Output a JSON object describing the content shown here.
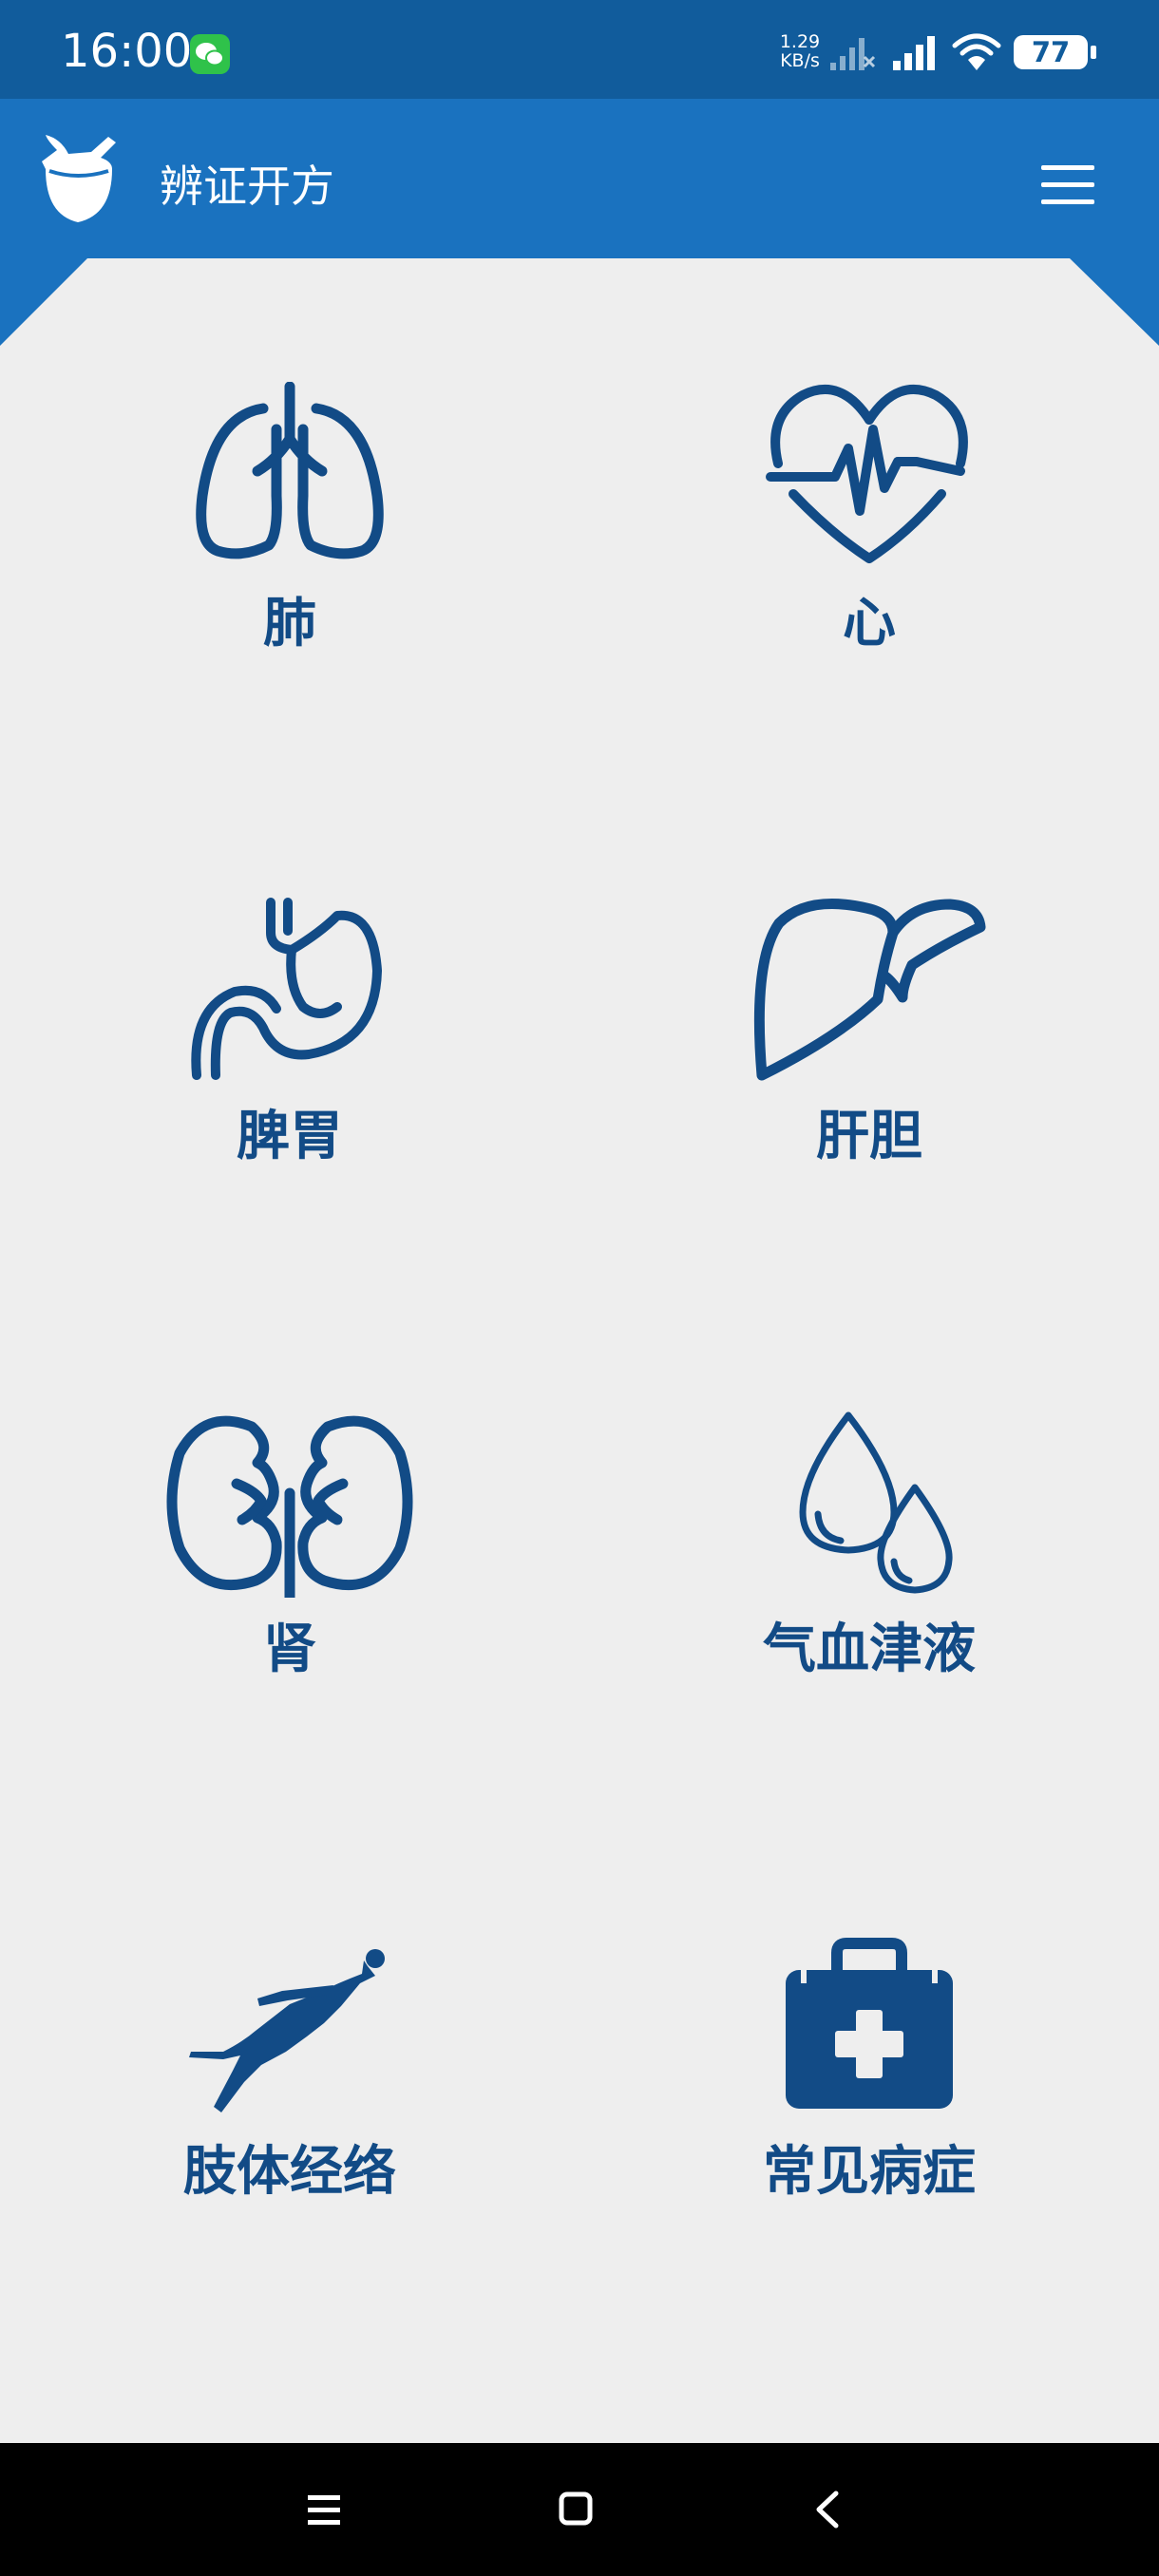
{
  "status_bar": {
    "time": "16:00",
    "net_speed_value": "1.29",
    "net_speed_unit": "KB/s",
    "battery": "77",
    "icons": [
      "wechat-notification-icon",
      "sim-signal-no-service-icon",
      "cellular-signal-icon",
      "wifi-icon",
      "battery-icon"
    ]
  },
  "header": {
    "title": "辨证开方",
    "logo_icon": "mortar-pestle-icon",
    "menu_icon": "hamburger-menu-icon"
  },
  "categories": [
    {
      "label": "肺",
      "icon": "lungs-icon"
    },
    {
      "label": "心",
      "icon": "heart-pulse-icon"
    },
    {
      "label": "脾胃",
      "icon": "stomach-icon"
    },
    {
      "label": "肝胆",
      "icon": "liver-icon"
    },
    {
      "label": "肾",
      "icon": "kidneys-icon"
    },
    {
      "label": "气血津液",
      "icon": "droplets-icon"
    },
    {
      "label": "肢体经络",
      "icon": "human-body-icon"
    },
    {
      "label": "常见病症",
      "icon": "first-aid-kit-icon"
    }
  ],
  "nav_bar": {
    "icons": [
      "recent-apps-icon",
      "home-icon",
      "back-icon"
    ]
  },
  "colors": {
    "status_bar": "#115c9c",
    "header": "#1a72bf",
    "icon_and_label": "#124b86",
    "background": "#eeeeee",
    "nav_bar": "#000000"
  }
}
